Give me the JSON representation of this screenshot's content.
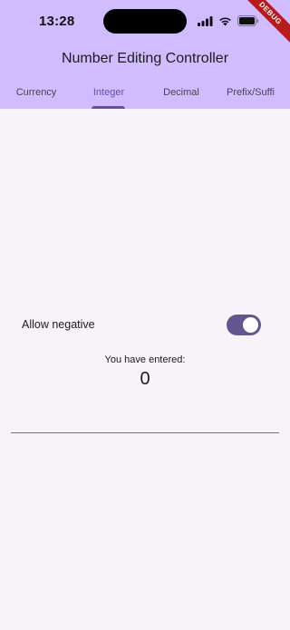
{
  "status_bar": {
    "time": "13:28",
    "icons": [
      "signal-icon",
      "wifi-icon",
      "battery-icon"
    ],
    "debug_banner": "DEBUG"
  },
  "app_bar": {
    "title": "Number Editing Controller",
    "background": "#d0bcff"
  },
  "tabs": [
    {
      "label": "Currency",
      "selected": false
    },
    {
      "label": "Integer",
      "selected": true
    },
    {
      "label": "Decimal",
      "selected": false
    },
    {
      "label": "Prefix/Suffi",
      "selected": false
    }
  ],
  "options": {
    "allow_negative_label": "Allow negative",
    "allow_negative_enabled": true
  },
  "result": {
    "label": "You have entered:",
    "value": "0"
  },
  "colors": {
    "accent": "#6750a4",
    "switch_track": "#65558f",
    "page_background": "#f7f3f9"
  }
}
